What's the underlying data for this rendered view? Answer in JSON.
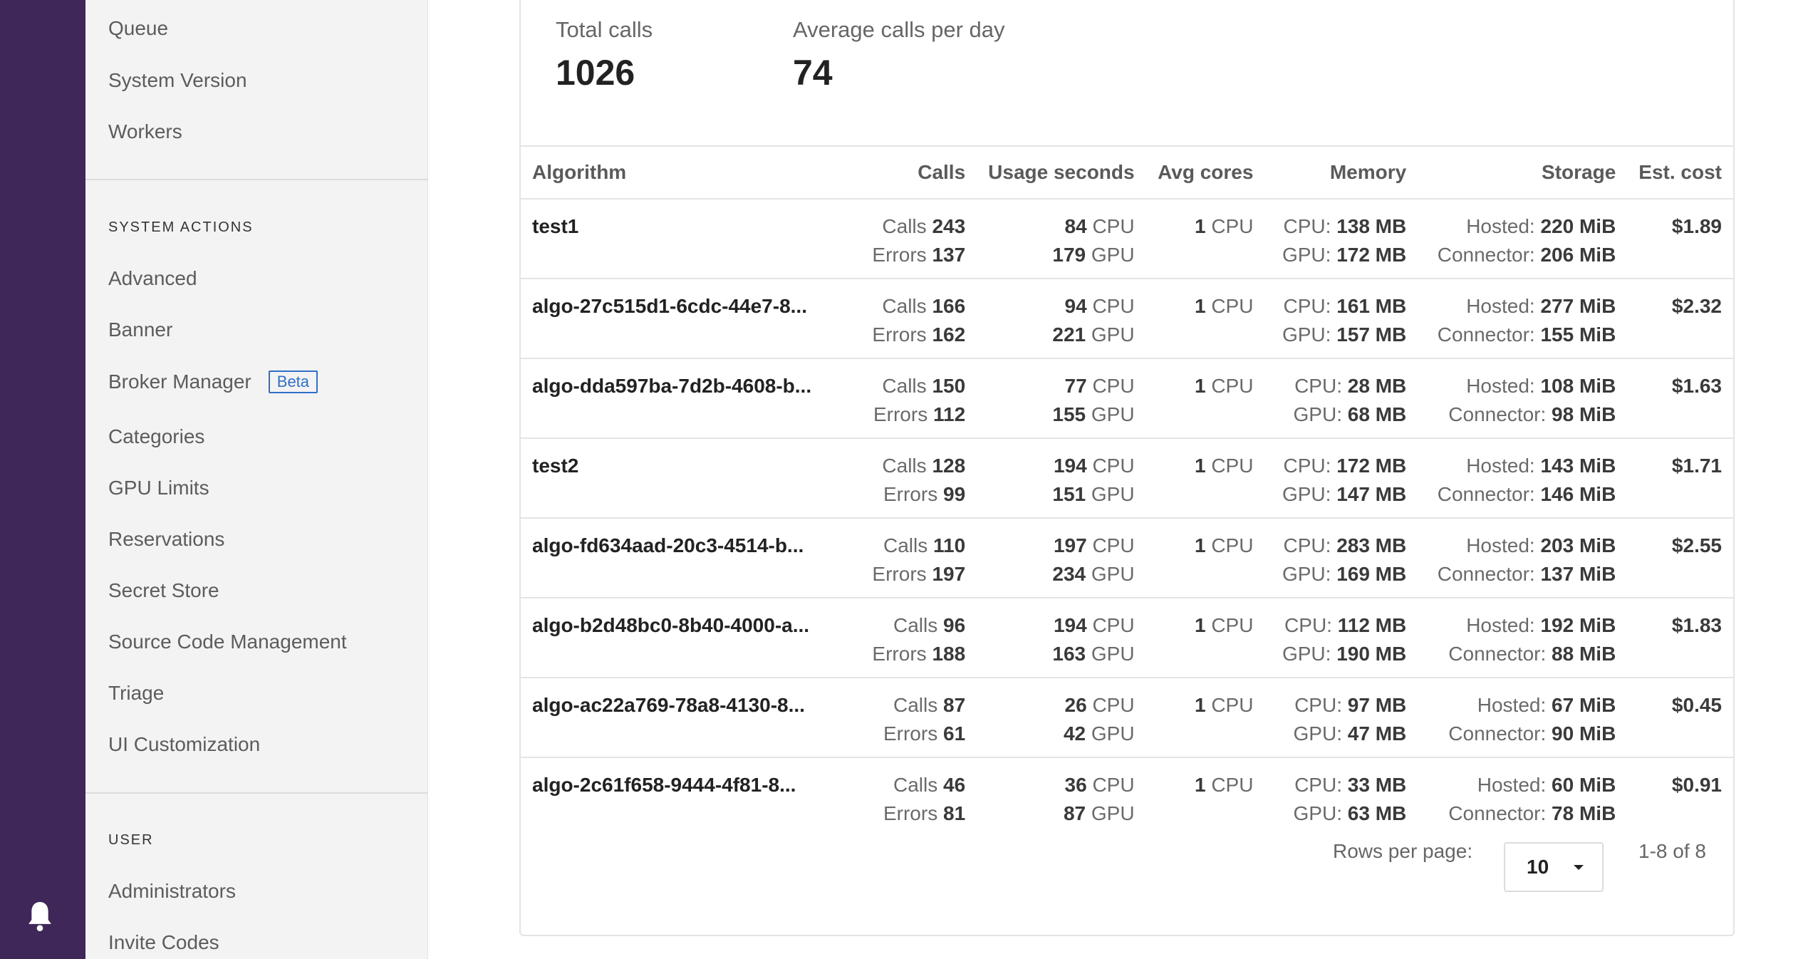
{
  "sidebar": {
    "top_items": [
      "Queue",
      "System Version",
      "Workers"
    ],
    "system_actions_heading": "SYSTEM ACTIONS",
    "system_actions": [
      "Advanced",
      "Banner",
      "Broker Manager",
      "Categories",
      "GPU Limits",
      "Reservations",
      "Secret Store",
      "Source Code Management",
      "Triage",
      "UI Customization"
    ],
    "beta_badge": "Beta",
    "user_heading": "USER",
    "user_items": [
      "Administrators",
      "Invite Codes"
    ]
  },
  "stats": {
    "total_calls_label": "Total calls",
    "total_calls_value": "1026",
    "avg_calls_label": "Average calls per day",
    "avg_calls_value": "74"
  },
  "table": {
    "columns": [
      "Algorithm",
      "Calls",
      "Usage seconds",
      "Avg cores",
      "Memory",
      "Storage",
      "Est. cost"
    ],
    "labels": {
      "calls": "Calls",
      "errors": "Errors",
      "cpu": "CPU",
      "gpu": "GPU",
      "cpu_prefix": "CPU:",
      "gpu_prefix": "GPU:",
      "hosted": "Hosted:",
      "connector": "Connector:"
    },
    "rows": [
      {
        "algorithm": "test1",
        "calls": "243",
        "errors": "137",
        "cpu_seconds": "84",
        "gpu_seconds": "179",
        "cores": "1",
        "cpu_mem": "138 MB",
        "gpu_mem": "172 MB",
        "hosted": "220 MiB",
        "connector": "206 MiB",
        "cost": "$1.89"
      },
      {
        "algorithm": "algo-27c515d1-6cdc-44e7-8...",
        "calls": "166",
        "errors": "162",
        "cpu_seconds": "94",
        "gpu_seconds": "221",
        "cores": "1",
        "cpu_mem": "161 MB",
        "gpu_mem": "157 MB",
        "hosted": "277 MiB",
        "connector": "155 MiB",
        "cost": "$2.32"
      },
      {
        "algorithm": "algo-dda597ba-7d2b-4608-b...",
        "calls": "150",
        "errors": "112",
        "cpu_seconds": "77",
        "gpu_seconds": "155",
        "cores": "1",
        "cpu_mem": "28 MB",
        "gpu_mem": "68 MB",
        "hosted": "108 MiB",
        "connector": "98 MiB",
        "cost": "$1.63"
      },
      {
        "algorithm": "test2",
        "calls": "128",
        "errors": "99",
        "cpu_seconds": "194",
        "gpu_seconds": "151",
        "cores": "1",
        "cpu_mem": "172 MB",
        "gpu_mem": "147 MB",
        "hosted": "143 MiB",
        "connector": "146 MiB",
        "cost": "$1.71"
      },
      {
        "algorithm": "algo-fd634aad-20c3-4514-b...",
        "calls": "110",
        "errors": "197",
        "cpu_seconds": "197",
        "gpu_seconds": "234",
        "cores": "1",
        "cpu_mem": "283 MB",
        "gpu_mem": "169 MB",
        "hosted": "203 MiB",
        "connector": "137 MiB",
        "cost": "$2.55"
      },
      {
        "algorithm": "algo-b2d48bc0-8b40-4000-a...",
        "calls": "96",
        "errors": "188",
        "cpu_seconds": "194",
        "gpu_seconds": "163",
        "cores": "1",
        "cpu_mem": "112 MB",
        "gpu_mem": "190 MB",
        "hosted": "192 MiB",
        "connector": "88 MiB",
        "cost": "$1.83"
      },
      {
        "algorithm": "algo-ac22a769-78a8-4130-8...",
        "calls": "87",
        "errors": "61",
        "cpu_seconds": "26",
        "gpu_seconds": "42",
        "cores": "1",
        "cpu_mem": "97 MB",
        "gpu_mem": "47 MB",
        "hosted": "67 MiB",
        "connector": "90 MiB",
        "cost": "$0.45"
      },
      {
        "algorithm": "algo-2c61f658-9444-4f81-8...",
        "calls": "46",
        "errors": "81",
        "cpu_seconds": "36",
        "gpu_seconds": "87",
        "cores": "1",
        "cpu_mem": "33 MB",
        "gpu_mem": "63 MB",
        "hosted": "60 MiB",
        "connector": "78 MiB",
        "cost": "$0.91"
      }
    ]
  },
  "pagination": {
    "rows_per_page_label": "Rows per page:",
    "rows_per_page_value": "10",
    "range": "1-8 of 8"
  },
  "icons": {
    "notification": "bell-icon",
    "dropdown": "caret-down-icon"
  },
  "colors": {
    "rail": "#3f2759",
    "sidebar": "#f3f3f3",
    "badge": "#2f6fc9"
  }
}
